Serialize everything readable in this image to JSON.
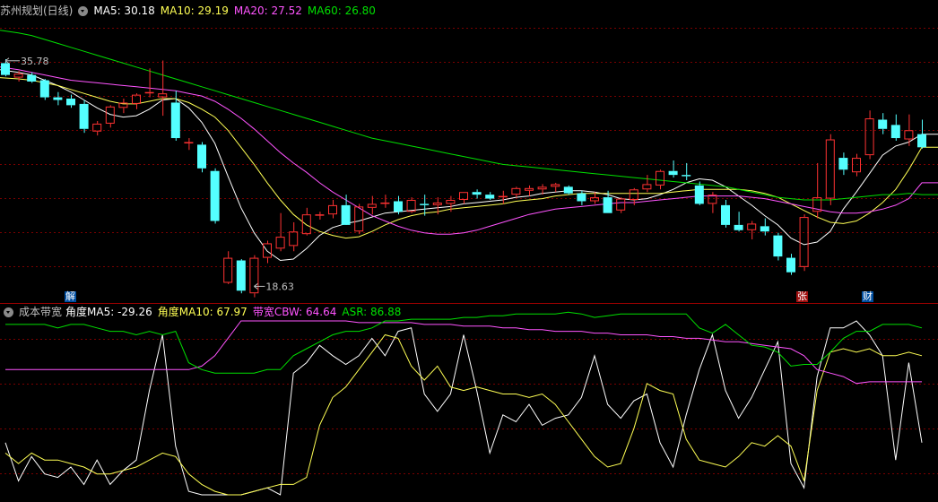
{
  "main_header": {
    "stock_name": "苏州规划(日线)",
    "ma5": "MA5: 30.18",
    "ma10": "MA10: 29.19",
    "ma20": "MA20: 27.52",
    "ma60": "MA60: 26.80"
  },
  "sub_header": {
    "indicator_name": "成本带宽",
    "angle_ma5": "角度MA5: -29.26",
    "angle_ma10": "角度MA10: 67.97",
    "cbw": "带宽CBW: 64.64",
    "asr": "ASR: 86.88"
  },
  "markers": {
    "high_label": "35.78",
    "low_label": "18.63",
    "jie": "解",
    "zhang": "张",
    "cai": "财"
  },
  "colors": {
    "up": "#ff3232",
    "down": "#54ffff",
    "ma5": "#ffffff",
    "ma10": "#ffff54",
    "ma20": "#ff54ff",
    "ma60": "#00e000",
    "grid": "#7a0000",
    "separator": "#9a0000",
    "text": "#c0c0c0"
  },
  "chart_data": [
    {
      "type": "candlestick",
      "title": "苏州规划(日线)",
      "ylim": [
        17.5,
        38.9
      ],
      "price_labels": {
        "high": 35.78,
        "low": 18.63
      },
      "ohlc": [
        [
          35.6,
          35.9,
          34.6,
          34.7
        ],
        [
          34.5,
          35.0,
          34.2,
          34.8
        ],
        [
          34.7,
          34.9,
          34.1,
          34.2
        ],
        [
          34.3,
          34.4,
          32.8,
          33.0
        ],
        [
          33.0,
          33.4,
          32.4,
          32.8
        ],
        [
          32.9,
          33.2,
          32.2,
          32.4
        ],
        [
          32.5,
          32.8,
          30.3,
          30.6
        ],
        [
          30.4,
          31.2,
          30.1,
          31.0
        ],
        [
          31.0,
          32.4,
          30.7,
          32.3
        ],
        [
          32.2,
          32.9,
          31.8,
          32.6
        ],
        [
          32.5,
          33.3,
          32.1,
          33.2
        ],
        [
          33.3,
          35.2,
          33.0,
          33.4
        ],
        [
          33.0,
          35.8,
          31.6,
          33.3
        ],
        [
          32.6,
          33.5,
          29.7,
          29.9
        ],
        [
          29.5,
          29.9,
          29.0,
          29.6
        ],
        [
          29.4,
          29.6,
          27.3,
          27.6
        ],
        [
          27.4,
          27.6,
          23.4,
          23.6
        ],
        [
          18.9,
          21.3,
          18.8,
          20.8
        ],
        [
          20.6,
          20.7,
          18.1,
          18.3
        ],
        [
          18.1,
          21.0,
          17.8,
          20.8
        ],
        [
          20.8,
          22.1,
          20.4,
          21.9
        ],
        [
          21.5,
          24.2,
          21.3,
          22.4
        ],
        [
          21.7,
          23.5,
          21.3,
          22.8
        ],
        [
          22.6,
          24.6,
          22.5,
          24.1
        ],
        [
          24.1,
          24.3,
          23.7,
          24.1
        ],
        [
          24.1,
          25.2,
          23.8,
          24.8
        ],
        [
          24.8,
          25.6,
          23.7,
          23.3
        ],
        [
          22.8,
          24.9,
          22.6,
          24.7
        ],
        [
          24.6,
          25.5,
          24.1,
          24.9
        ],
        [
          24.9,
          25.6,
          24.6,
          25.0
        ],
        [
          25.1,
          25.5,
          24.1,
          24.3
        ],
        [
          24.3,
          25.4,
          24.2,
          25.2
        ],
        [
          24.9,
          25.6,
          24.0,
          24.8
        ],
        [
          24.8,
          25.4,
          24.1,
          25.0
        ],
        [
          24.9,
          25.5,
          24.3,
          25.2
        ],
        [
          25.2,
          25.8,
          24.9,
          25.8
        ],
        [
          25.8,
          26.0,
          25.3,
          25.6
        ],
        [
          25.6,
          25.8,
          25.2,
          25.3
        ],
        [
          25.4,
          25.9,
          24.9,
          25.5
        ],
        [
          25.6,
          26.2,
          25.4,
          26.1
        ],
        [
          25.9,
          26.3,
          25.5,
          26.1
        ],
        [
          26.0,
          26.4,
          25.6,
          26.2
        ],
        [
          26.2,
          26.5,
          25.8,
          26.4
        ],
        [
          26.2,
          26.3,
          25.6,
          25.7
        ],
        [
          25.7,
          25.9,
          24.8,
          25.1
        ],
        [
          25.1,
          25.8,
          24.9,
          25.4
        ],
        [
          25.4,
          25.9,
          24.2,
          24.2
        ],
        [
          24.4,
          25.4,
          24.2,
          25.3
        ],
        [
          25.2,
          26.1,
          24.8,
          26.0
        ],
        [
          26.0,
          27.1,
          25.8,
          26.4
        ],
        [
          26.3,
          27.5,
          26.0,
          27.4
        ],
        [
          27.4,
          28.2,
          26.9,
          27.1
        ],
        [
          27.1,
          28.0,
          26.7,
          27.0
        ],
        [
          26.3,
          26.6,
          24.8,
          24.9
        ],
        [
          24.9,
          25.8,
          24.2,
          25.6
        ],
        [
          24.8,
          25.2,
          23.1,
          23.3
        ],
        [
          23.3,
          24.3,
          22.8,
          22.9
        ],
        [
          22.9,
          23.6,
          22.2,
          23.4
        ],
        [
          23.2,
          23.8,
          22.5,
          22.8
        ],
        [
          22.5,
          22.7,
          20.6,
          20.9
        ],
        [
          20.8,
          21.1,
          19.5,
          19.7
        ],
        [
          20.1,
          24.1,
          19.8,
          23.9
        ],
        [
          24.3,
          28.0,
          23.8,
          25.4
        ],
        [
          25.3,
          30.2,
          24.8,
          29.8
        ],
        [
          28.4,
          28.8,
          27.1,
          27.5
        ],
        [
          27.3,
          28.7,
          27.0,
          28.4
        ],
        [
          28.6,
          32.0,
          28.3,
          31.4
        ],
        [
          31.3,
          31.8,
          30.2,
          30.6
        ],
        [
          30.9,
          31.7,
          29.7,
          29.9
        ],
        [
          29.8,
          31.7,
          29.3,
          30.5
        ],
        [
          30.2,
          31.3,
          29.1,
          29.2
        ]
      ],
      "series": [
        {
          "name": "MA5",
          "value": 30.18
        },
        {
          "name": "MA10",
          "value": 29.19
        },
        {
          "name": "MA20",
          "value": 27.52
        },
        {
          "name": "MA60",
          "value": 26.8
        }
      ],
      "ma_lines": {
        "MA5": [
          35.1,
          34.9,
          34.7,
          34.3,
          33.9,
          33.4,
          32.8,
          32.2,
          31.7,
          31.5,
          31.6,
          32.1,
          32.8,
          32.9,
          32.2,
          31.1,
          29.5,
          27.0,
          24.6,
          22.7,
          21.3,
          20.6,
          20.7,
          21.5,
          22.5,
          23.1,
          23.4,
          23.6,
          23.9,
          24.2,
          24.3,
          24.4,
          24.5,
          24.6,
          24.7,
          24.9,
          25.0,
          25.1,
          25.2,
          25.4,
          25.5,
          25.7,
          25.8,
          25.9,
          25.9,
          25.8,
          25.6,
          25.3,
          25.2,
          25.3,
          25.6,
          26.0,
          26.5,
          26.8,
          26.7,
          26.2,
          25.5,
          24.8,
          24.0,
          23.3,
          22.3,
          21.8,
          22.0,
          22.8,
          24.5,
          25.8,
          27.2,
          28.6,
          29.3,
          29.6,
          30.2
        ],
        "MA10": [
          34.5,
          34.4,
          34.3,
          34.1,
          33.9,
          33.6,
          33.3,
          33.0,
          32.7,
          32.5,
          32.5,
          32.7,
          32.9,
          32.9,
          32.6,
          32.1,
          31.5,
          30.5,
          29.2,
          27.9,
          26.5,
          25.2,
          24.1,
          23.3,
          22.8,
          22.5,
          22.3,
          22.4,
          22.8,
          23.3,
          23.7,
          24.0,
          24.2,
          24.3,
          24.5,
          24.6,
          24.7,
          24.8,
          24.9,
          25.1,
          25.2,
          25.3,
          25.5,
          25.6,
          25.7,
          25.7,
          25.7,
          25.7,
          25.7,
          25.7,
          25.7,
          25.8,
          25.9,
          26.0,
          26.0,
          26.0,
          26.0,
          25.9,
          25.7,
          25.4,
          24.9,
          24.4,
          23.9,
          23.5,
          23.4,
          23.6,
          24.2,
          25.0,
          26.0,
          27.5,
          29.2
        ],
        "MA20": [
          35.3,
          35.1,
          34.9,
          34.7,
          34.5,
          34.3,
          34.2,
          34.1,
          34.0,
          33.9,
          33.8,
          33.7,
          33.6,
          33.5,
          33.3,
          33.1,
          32.7,
          32.1,
          31.4,
          30.6,
          29.7,
          28.8,
          28.0,
          27.3,
          26.5,
          25.8,
          25.2,
          24.6,
          24.0,
          23.6,
          23.2,
          22.9,
          22.7,
          22.6,
          22.6,
          22.7,
          22.9,
          23.2,
          23.5,
          23.8,
          24.1,
          24.3,
          24.5,
          24.6,
          24.7,
          24.8,
          24.9,
          25.0,
          25.0,
          25.1,
          25.2,
          25.3,
          25.4,
          25.5,
          25.5,
          25.5,
          25.5,
          25.4,
          25.3,
          25.1,
          24.9,
          24.7,
          24.5,
          24.3,
          24.2,
          24.2,
          24.3,
          24.5,
          24.8,
          25.3,
          26.5
        ],
        "MA60": [
          38.1,
          37.9,
          37.7,
          37.4,
          37.1,
          36.8,
          36.5,
          36.2,
          35.9,
          35.6,
          35.3,
          35.0,
          34.7,
          34.4,
          34.1,
          33.8,
          33.5,
          33.2,
          32.9,
          32.6,
          32.3,
          32.0,
          31.7,
          31.4,
          31.1,
          30.8,
          30.5,
          30.2,
          29.9,
          29.7,
          29.5,
          29.3,
          29.1,
          28.9,
          28.7,
          28.5,
          28.3,
          28.1,
          27.9,
          27.8,
          27.7,
          27.6,
          27.5,
          27.4,
          27.3,
          27.2,
          27.1,
          27.0,
          26.9,
          26.8,
          26.7,
          26.6,
          26.5,
          26.4,
          26.3,
          26.2,
          26.0,
          25.8,
          25.6,
          25.4,
          25.3,
          25.2,
          25.2,
          25.2,
          25.3,
          25.4,
          25.5,
          25.6,
          25.6,
          25.7,
          25.6
        ]
      }
    },
    {
      "type": "line",
      "title": "成本带宽",
      "ylim": [
        0,
        100
      ],
      "series": [
        {
          "name": "角度MA5",
          "value": -29.26,
          "values": [
            30,
            8,
            22,
            12,
            10,
            16,
            6,
            20,
            6,
            14,
            20,
            60,
            92,
            28,
            2,
            0,
            0,
            0,
            0,
            2,
            4,
            0,
            70,
            76,
            86,
            80,
            75,
            80,
            90,
            80,
            94,
            96,
            58,
            48,
            58,
            92,
            60,
            24,
            46,
            42,
            52,
            40,
            44,
            46,
            56,
            80,
            52,
            44,
            54,
            58,
            30,
            16,
            46,
            72,
            92,
            60,
            44,
            56,
            72,
            88,
            18,
            4,
            68,
            96,
            96,
            100,
            92,
            80,
            20,
            76,
            30
          ]
        },
        {
          "name": "角度MA10",
          "value": 67.97,
          "values": [
            24,
            18,
            24,
            20,
            20,
            18,
            16,
            12,
            12,
            14,
            16,
            20,
            24,
            22,
            12,
            6,
            2,
            0,
            0,
            2,
            4,
            6,
            6,
            10,
            40,
            56,
            62,
            72,
            82,
            92,
            90,
            74,
            66,
            74,
            62,
            60,
            62,
            60,
            58,
            58,
            56,
            58,
            52,
            42,
            32,
            22,
            16,
            18,
            38,
            64,
            60,
            58,
            32,
            20,
            18,
            16,
            22,
            30,
            28,
            34,
            28,
            8,
            60,
            82,
            84,
            82,
            84,
            80,
            80,
            82,
            80
          ]
        },
        {
          "name": "带宽CBW",
          "value": 64.64,
          "values": [
            72,
            72,
            72,
            72,
            72,
            72,
            72,
            72,
            72,
            72,
            72,
            72,
            72,
            72,
            72,
            74,
            80,
            90,
            100,
            100,
            100,
            100,
            100,
            100,
            100,
            100,
            100,
            99,
            99,
            99,
            99,
            99,
            98,
            98,
            98,
            97,
            97,
            97,
            96,
            96,
            95,
            95,
            94,
            94,
            94,
            93,
            93,
            92,
            92,
            92,
            91,
            91,
            90,
            90,
            89,
            88,
            88,
            87,
            86,
            85,
            84,
            80,
            72,
            70,
            68,
            64,
            65,
            65,
            65,
            65,
            65
          ]
        },
        {
          "name": "ASR",
          "value": 86.88,
          "values": [
            98,
            98,
            98,
            98,
            96,
            98,
            98,
            96,
            94,
            94,
            92,
            94,
            92,
            94,
            76,
            72,
            70,
            70,
            70,
            70,
            72,
            72,
            80,
            84,
            88,
            92,
            94,
            94,
            96,
            100,
            100,
            101,
            101,
            101,
            101,
            102,
            102,
            103,
            103,
            104,
            104,
            104,
            104,
            105,
            104,
            102,
            103,
            104,
            104,
            104,
            104,
            104,
            104,
            96,
            93,
            98,
            92,
            86,
            85,
            82,
            74,
            75,
            75,
            82,
            90,
            94,
            94,
            98,
            98,
            98,
            96
          ]
        }
      ]
    }
  ]
}
